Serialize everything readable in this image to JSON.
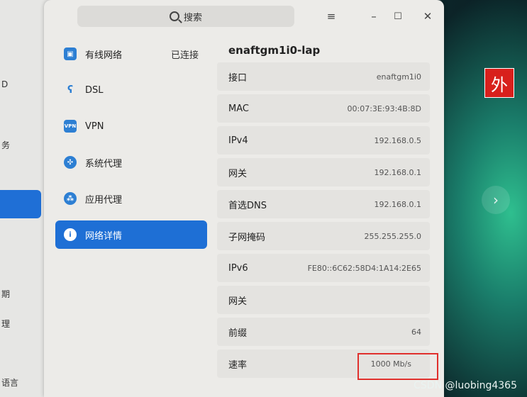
{
  "search": {
    "label": "搜索"
  },
  "window_controls": {
    "menu": "≡",
    "minimize": "–",
    "maximize": "☐",
    "close": "✕"
  },
  "left_fragments": [
    "D",
    "务",
    "期",
    "理",
    "语言"
  ],
  "sidebar": {
    "items": [
      {
        "label": "有线网络",
        "status": "已连接",
        "icon": "ethernet-icon"
      },
      {
        "label": "DSL",
        "status": "",
        "icon": "dsl-icon"
      },
      {
        "label": "VPN",
        "status": "",
        "icon": "vpn-icon"
      },
      {
        "label": "系统代理",
        "status": "",
        "icon": "system-proxy-icon"
      },
      {
        "label": "应用代理",
        "status": "",
        "icon": "app-proxy-icon"
      },
      {
        "label": "网络详情",
        "status": "",
        "icon": "info-icon",
        "active": true
      }
    ]
  },
  "detail": {
    "title": "enaftgm1i0-lap",
    "rows": [
      {
        "label": "接口",
        "value": "enaftgm1i0"
      },
      {
        "label": "MAC",
        "value": "00:07:3E:93:4B:8D"
      },
      {
        "label": "IPv4",
        "value": "192.168.0.5"
      },
      {
        "label": "网关",
        "value": "192.168.0.1"
      },
      {
        "label": "首选DNS",
        "value": "192.168.0.1"
      },
      {
        "label": "子网掩码",
        "value": "255.255.255.0"
      },
      {
        "label": "IPv6",
        "value": "FE80::6C62:58D4:1A14:2E65"
      },
      {
        "label": "网关",
        "value": ""
      },
      {
        "label": "前缀",
        "value": "64"
      },
      {
        "label": "速率",
        "value": "1000 Mb/s"
      }
    ]
  },
  "desktop": {
    "badge": "外",
    "arrow": "›"
  },
  "watermark": "CSDN @luobing4365",
  "colors": {
    "accent": "#1e6fd5",
    "highlight": "#e0302d",
    "badge": "#d8201c"
  }
}
